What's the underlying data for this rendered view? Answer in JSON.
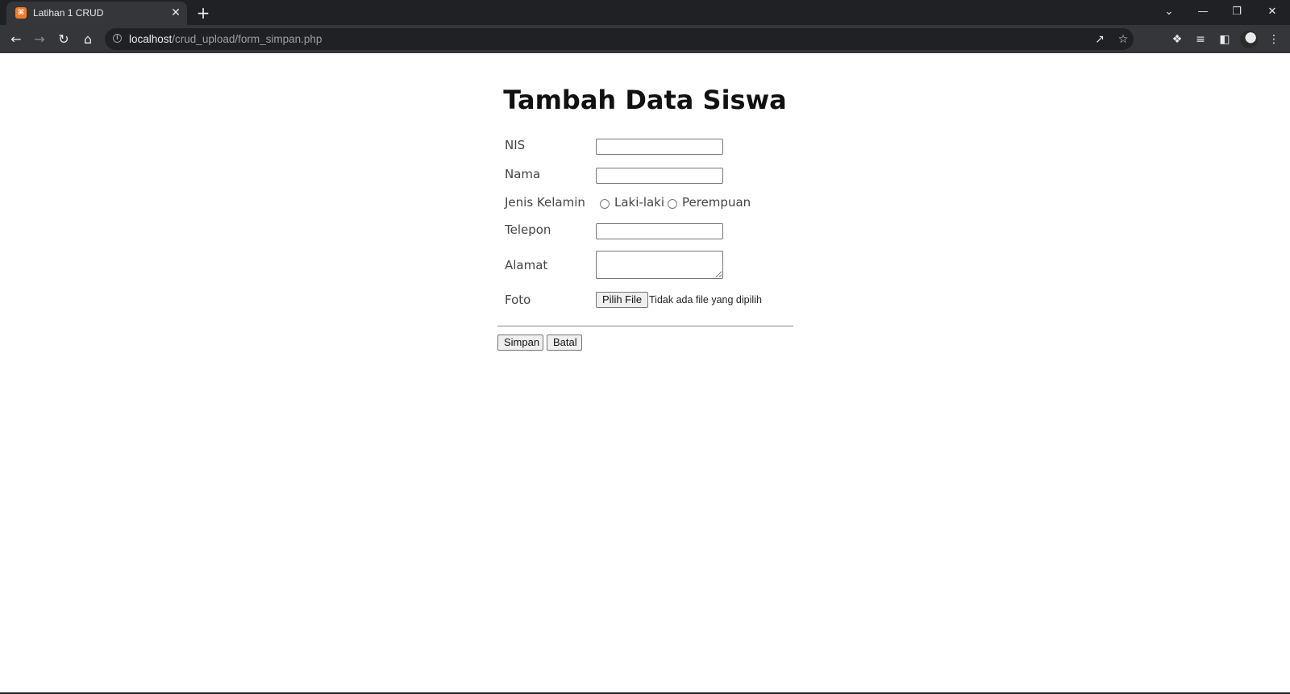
{
  "browser": {
    "tab": {
      "title": "Latihan 1 CRUD",
      "favicon": "xampp-icon"
    },
    "url": {
      "host": "localhost",
      "path": "/crud_upload/form_simpan.php"
    }
  },
  "page": {
    "title": "Tambah Data Siswa",
    "form": {
      "nis_label": "NIS",
      "nama_label": "Nama",
      "gender_label": "Jenis Kelamin",
      "gender_options": [
        "Laki-laki",
        "Perempuan"
      ],
      "telepon_label": "Telepon",
      "alamat_label": "Alamat",
      "foto_label": "Foto",
      "file_button": "Pilih File",
      "file_status": "Tidak ada file yang dipilih",
      "submit_label": "Simpan",
      "cancel_label": "Batal"
    }
  }
}
